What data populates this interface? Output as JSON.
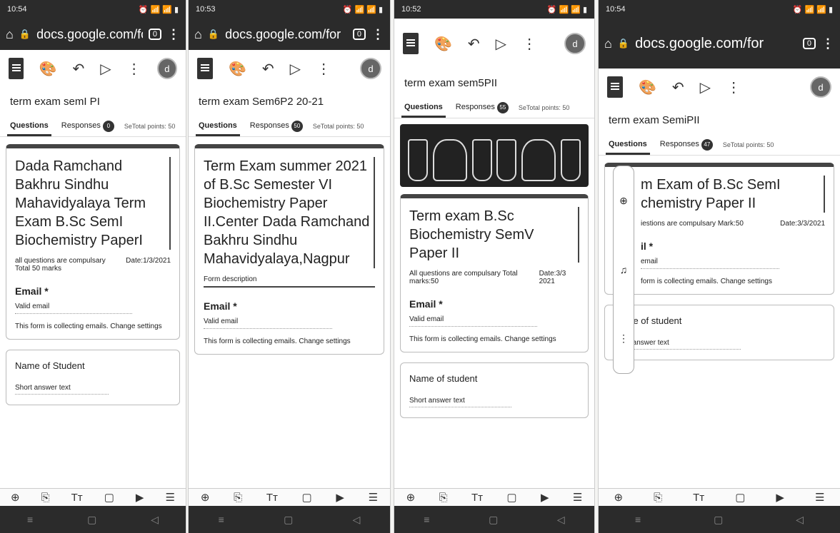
{
  "phones": [
    {
      "status_time": "10:54",
      "status_icons": "⏰ 📶 📶 ▮",
      "url": "docs.google.com/for",
      "tab_count": "0",
      "avatar": "d",
      "form_title": "term exam semI PI",
      "tabs": {
        "questions": "Questions",
        "responses": "Responses",
        "responses_count": "0",
        "points": "SeTotal points: 50"
      },
      "card_title": "Dada Ramchand Bakhru Sindhu Mahavidyalaya Term Exam B.Sc SemI Biochemistry PaperI",
      "card_desc_left": "all questions are compulsary Total 50 marks",
      "card_desc_right": "Date:1/3/2021",
      "email_label": "Email *",
      "email_value": "Valid email",
      "note": "This form is collecting emails. Change settings",
      "question": "Name of Student",
      "answer": "Short answer text"
    },
    {
      "status_time": "10:53",
      "status_icons": "⏰ 📶 📶 ▮",
      "url": "docs.google.com/for",
      "tab_count": "0",
      "avatar": "d",
      "form_title": "term exam Sem6P2 20-21",
      "tabs": {
        "questions": "Questions",
        "responses": "Responses",
        "responses_count": "50",
        "points": "SeTotal points: 50"
      },
      "card_title": "Term Exam summer 2021 of B.Sc Semester VI Biochemistry Paper II.Center Dada Ramchand Bakhru Sindhu Mahavidyalaya,Nagpur",
      "card_desc_left": "Form description",
      "card_desc_right": "",
      "email_label": "Email *",
      "email_value": "Valid email",
      "note": "This form is collecting emails. Change settings",
      "question": "",
      "answer": ""
    },
    {
      "status_time": "10:52",
      "status_icons": "⏰ 📶 📶 ▮",
      "avatar": "d",
      "form_title": "term exam sem5PII",
      "tabs": {
        "questions": "Questions",
        "responses": "Responses",
        "responses_count": "55",
        "points": "SeTotal points: 50"
      },
      "card_title": "Term exam B.Sc Biochemistry SemV Paper II",
      "card_desc_left": "All questions are compulsary Total marks:50",
      "card_desc_right": "Date:3/3 2021",
      "email_label": "Email *",
      "email_value": "Valid email",
      "note": "This form is collecting emails. Change settings",
      "question": "Name of student",
      "answer": "Short answer text"
    },
    {
      "status_time": "10:54",
      "status_icons": "⏰ 📶 📶 ▮",
      "url": "docs.google.com/for",
      "tab_count": "0",
      "avatar": "d",
      "form_title": "term exam SemiPII",
      "tabs": {
        "questions": "Questions",
        "responses": "Responses",
        "responses_count": "47",
        "points": "SeTotal points: 50"
      },
      "card_title": "m Exam of B.Sc SemI chemistry Paper II",
      "card_desc_left": "iestions are compulsary Mark:50",
      "card_desc_right": "Date:3/3/2021",
      "email_label": "il *",
      "email_value": "email",
      "note": "form is collecting emails. Change settings",
      "question": "Name of student",
      "answer": "Short answer text"
    }
  ],
  "bottom_toolbar": [
    "⊕",
    "⎘",
    "Tт",
    "▢",
    "▶",
    "☰"
  ],
  "nav_icons": [
    "≡",
    "▢",
    "◁"
  ]
}
